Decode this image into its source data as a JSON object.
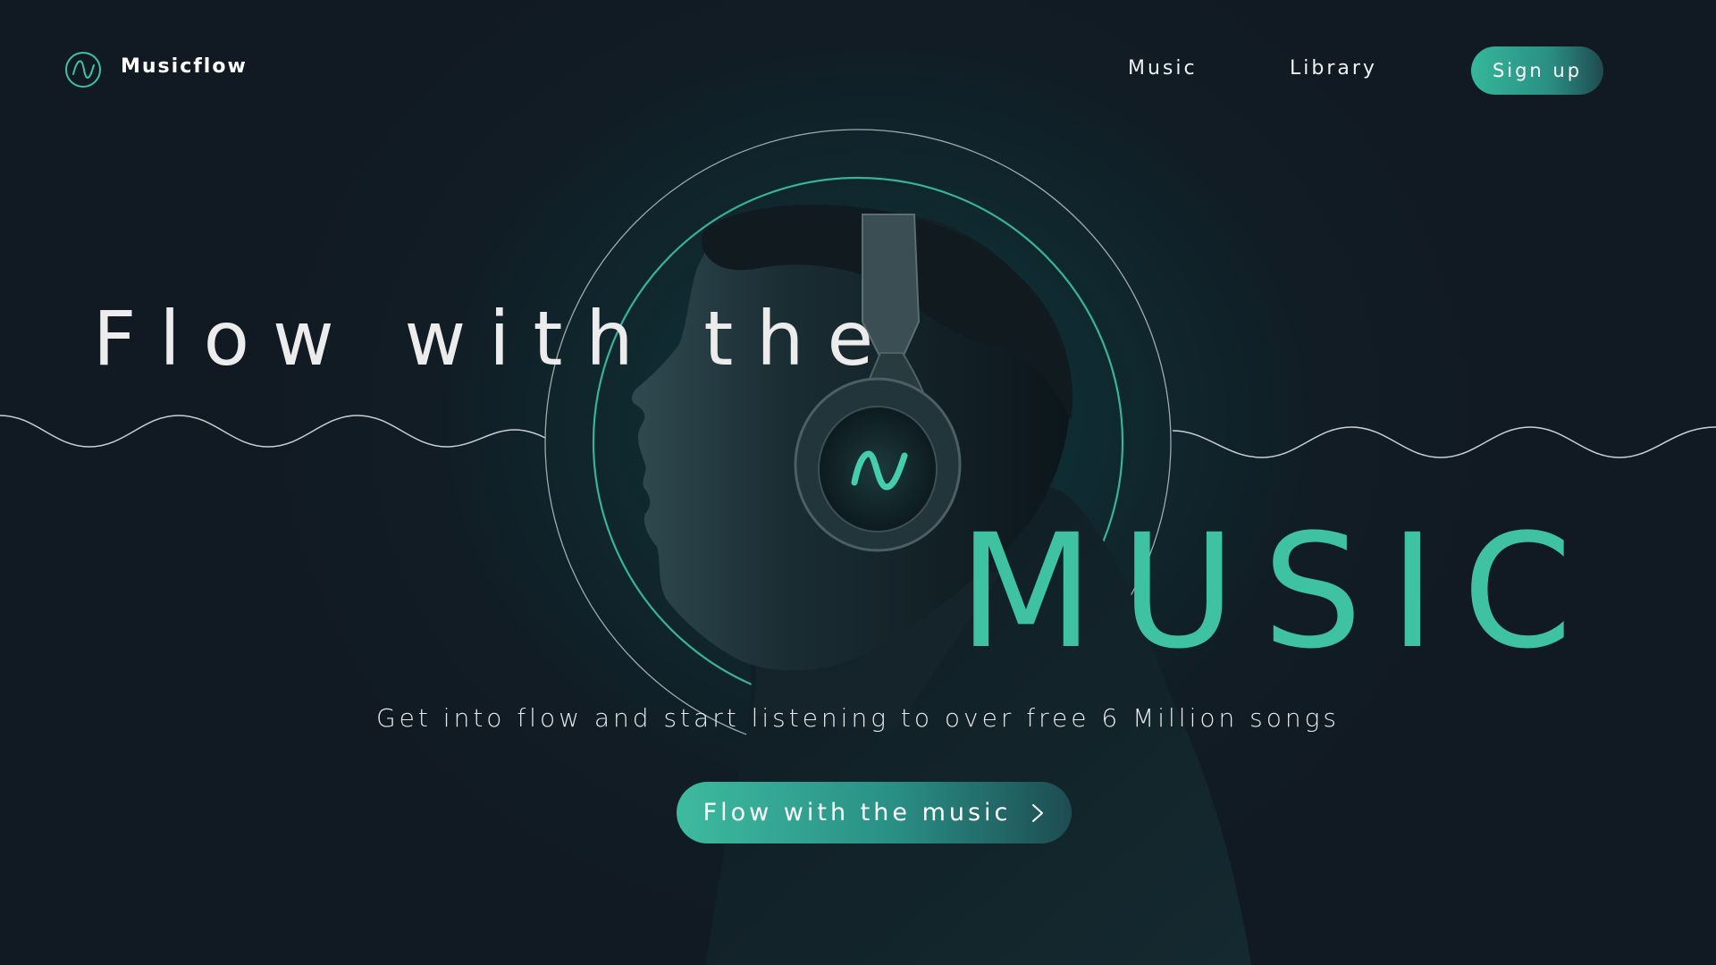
{
  "header": {
    "brand_name": "Musicflow",
    "logo_icon": "wave-logo-icon",
    "nav": [
      {
        "label": "Music"
      },
      {
        "label": "Library"
      }
    ],
    "signup_label": "Sign up"
  },
  "hero": {
    "title_line1": "Flow with the",
    "title_line2": "MUSIC",
    "subtitle": "Get into flow and start listening to over free 6 Million songs",
    "cta_label": "Flow with the music",
    "cta_icon": "chevron-right-icon"
  },
  "colors": {
    "accent": "#3ec2a2",
    "background": "#111a22",
    "text": "#ffffff"
  }
}
